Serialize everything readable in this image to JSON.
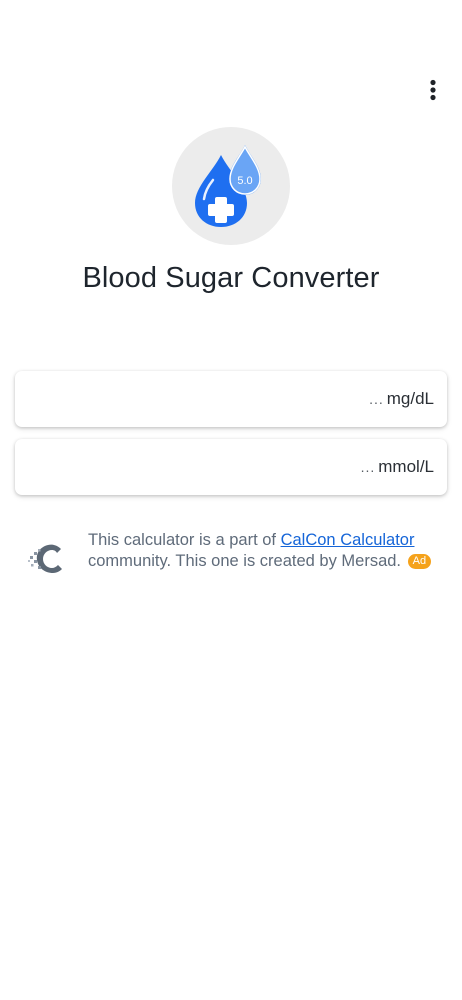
{
  "app": {
    "title": "Blood Sugar Converter"
  },
  "header": {
    "menu_icon": "more-vertical-icon"
  },
  "logo": {
    "icon": "blood-drop-plus-icon",
    "badge_value": "5.0",
    "colors": {
      "circle_bg": "#ececec",
      "drop_primary": "#1f6ff0",
      "drop_secondary": "#6aa5f5"
    }
  },
  "converter": {
    "mgdl": {
      "unit": "mg/dL",
      "placeholder": "...",
      "value": ""
    },
    "mmol": {
      "unit": "mmol/L",
      "placeholder": "...",
      "value": ""
    }
  },
  "footer": {
    "icon": "calcon-logo-icon",
    "text_before": "This calculator is a part of ",
    "link_text": "CalCon Calculator",
    "text_after": " community. This one is created by Mersad.",
    "badge": "Ad",
    "colors": {
      "link": "#1565d8",
      "text": "#5f6b7a",
      "badge": "#f5a21b"
    }
  }
}
